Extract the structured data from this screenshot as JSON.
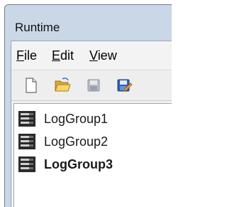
{
  "window": {
    "title": "Runtime"
  },
  "menu": {
    "items": [
      {
        "mnemonic": "F",
        "rest": "ile"
      },
      {
        "mnemonic": "E",
        "rest": "dit"
      },
      {
        "mnemonic": "V",
        "rest": "iew"
      }
    ]
  },
  "toolbar": {
    "buttons": [
      {
        "icon": "new-document-icon"
      },
      {
        "icon": "open-folder-icon"
      },
      {
        "icon": "save-icon-disabled"
      },
      {
        "icon": "save-as-icon"
      }
    ]
  },
  "tree": {
    "items": [
      {
        "label": "LogGroup1",
        "icon": "log-group-icon",
        "selected": false
      },
      {
        "label": "LogGroup2",
        "icon": "log-group-icon",
        "selected": false
      },
      {
        "label": "LogGroup3",
        "icon": "log-group-icon",
        "selected": true
      }
    ]
  },
  "colors": {
    "frame": "#cad7e6",
    "client": "#f0f0f0",
    "folder": "#f2c14b",
    "disk_blue": "#2f5fb3"
  }
}
